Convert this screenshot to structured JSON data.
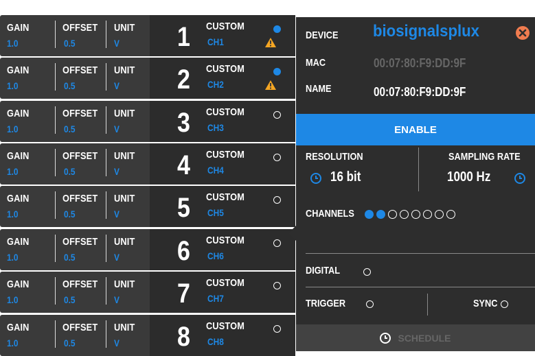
{
  "channels": [
    {
      "num": "1",
      "gain_label": "GAIN",
      "gain": "1.0",
      "offset_label": "OFFSET",
      "offset": "0.5",
      "unit_label": "UNIT",
      "unit": "V",
      "type": "CUSTOM",
      "name": "CH1",
      "active": true,
      "warning": true
    },
    {
      "num": "2",
      "gain_label": "GAIN",
      "gain": "1.0",
      "offset_label": "OFFSET",
      "offset": "0.5",
      "unit_label": "UNIT",
      "unit": "V",
      "type": "CUSTOM",
      "name": "CH2",
      "active": true,
      "warning": true
    },
    {
      "num": "3",
      "gain_label": "GAIN",
      "gain": "1.0",
      "offset_label": "OFFSET",
      "offset": "0.5",
      "unit_label": "UNIT",
      "unit": "V",
      "type": "CUSTOM",
      "name": "CH3",
      "active": false,
      "warning": false
    },
    {
      "num": "4",
      "gain_label": "GAIN",
      "gain": "1.0",
      "offset_label": "OFFSET",
      "offset": "0.5",
      "unit_label": "UNIT",
      "unit": "V",
      "type": "CUSTOM",
      "name": "CH4",
      "active": false,
      "warning": false
    },
    {
      "num": "5",
      "gain_label": "GAIN",
      "gain": "1.0",
      "offset_label": "OFFSET",
      "offset": "0.5",
      "unit_label": "UNIT",
      "unit": "V",
      "type": "CUSTOM",
      "name": "CH5",
      "active": false,
      "warning": false
    },
    {
      "num": "6",
      "gain_label": "GAIN",
      "gain": "1.0",
      "offset_label": "OFFSET",
      "offset": "0.5",
      "unit_label": "UNIT",
      "unit": "V",
      "type": "CUSTOM",
      "name": "CH6",
      "active": false,
      "warning": false
    },
    {
      "num": "7",
      "gain_label": "GAIN",
      "gain": "1.0",
      "offset_label": "OFFSET",
      "offset": "0.5",
      "unit_label": "UNIT",
      "unit": "V",
      "type": "CUSTOM",
      "name": "CH7",
      "active": false,
      "warning": false
    },
    {
      "num": "8",
      "gain_label": "GAIN",
      "gain": "1.0",
      "offset_label": "OFFSET",
      "offset": "0.5",
      "unit_label": "UNIT",
      "unit": "V",
      "type": "CUSTOM",
      "name": "CH8",
      "active": false,
      "warning": false
    }
  ],
  "device": {
    "device_label": "DEVICE",
    "logo_text": "biosignalsplux",
    "mac_label": "MAC",
    "mac_value": "00:07:80:F9:DD:9F",
    "name_label": "NAME",
    "name_value": "00:07:80:F9:DD:9F",
    "enable_label": "ENABLE",
    "resolution_label": "RESOLUTION",
    "resolution_value": "16 bit",
    "sampling_label": "SAMPLING RATE",
    "sampling_value": "1000 Hz",
    "channels_label": "CHANNELS",
    "channel_states": [
      true,
      true,
      false,
      false,
      false,
      false,
      false,
      false
    ],
    "digital_label": "DIGITAL",
    "trigger_label": "TRIGGER",
    "sync_label": "SYNC",
    "schedule_label": "SCHEDULE"
  },
  "colors": {
    "accent": "#1e88e5",
    "close": "#f07c4f",
    "warning": "#f5a623",
    "row_bg": "#3a3a3a",
    "panel_bg": "#2d2d2d"
  },
  "icons": {
    "close": "close-x-icon",
    "warning": "warning-triangle-icon",
    "clock": "clock-icon"
  }
}
